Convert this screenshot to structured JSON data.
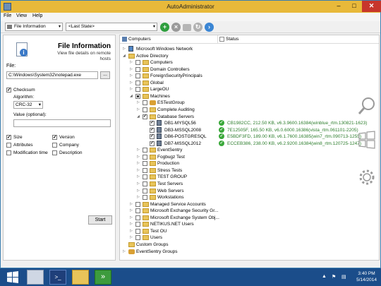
{
  "window": {
    "title": "AutoAdministrator",
    "controls": {
      "minimize": "–",
      "maximize": "□",
      "close": "✕"
    }
  },
  "menu": [
    "File",
    "View",
    "Help"
  ],
  "toolbar": {
    "action_combo": "File Information",
    "state_combo": "<Last State>",
    "buttons": [
      "run",
      "stop",
      "export",
      "refresh",
      "forward"
    ]
  },
  "left_panel": {
    "heading": "File Information",
    "description": "View file details on remote hosts",
    "file_label": "File:",
    "file_value": "C:\\Windows\\System32\\notepad.exe",
    "browse_label": "...",
    "checksum": {
      "label": "Checksum",
      "checked": true
    },
    "algorithm_label": "Algorithm:",
    "algorithm_value": "CRC-32",
    "optional_label": "Value (optional):",
    "optional_value": "",
    "options": [
      {
        "label": "Size",
        "checked": true
      },
      {
        "label": "Version",
        "checked": true
      },
      {
        "label": "Attributes",
        "checked": false
      },
      {
        "label": "Company",
        "checked": false
      },
      {
        "label": "Modification time",
        "checked": false
      },
      {
        "label": "Description",
        "checked": false
      }
    ],
    "start_label": "Start"
  },
  "right_panel": {
    "col_computers": "Computers",
    "col_status": "Status",
    "tree": [
      {
        "label": "Microsoft Windows Network",
        "level": 0,
        "icon": "network",
        "exp": "▷",
        "cb": false
      },
      {
        "label": "Active Directory",
        "level": 0,
        "icon": "folder",
        "exp": "◢",
        "cb": false
      },
      {
        "label": "Computers",
        "level": 1,
        "icon": "folder",
        "exp": "▷",
        "cb": true,
        "checked": false
      },
      {
        "label": "Domain Controllers",
        "level": 1,
        "icon": "folder",
        "exp": "▷",
        "cb": true,
        "checked": false
      },
      {
        "label": "ForeignSecurityPrincipals",
        "level": 1,
        "icon": "folder",
        "exp": "▷",
        "cb": true,
        "checked": false
      },
      {
        "label": "Global",
        "level": 1,
        "icon": "folder",
        "exp": "▷",
        "cb": true,
        "checked": false
      },
      {
        "label": "LargeOU",
        "level": 1,
        "icon": "folder",
        "exp": "▷",
        "cb": true,
        "checked": false
      },
      {
        "label": "Machines",
        "level": 1,
        "icon": "folder",
        "exp": "◢",
        "cb": true,
        "checked": "partial"
      },
      {
        "label": "ESTestGroup",
        "level": 2,
        "icon": "group",
        "exp": "▷",
        "cb": true,
        "checked": false
      },
      {
        "label": "Complete Auditing",
        "level": 2,
        "icon": "folder",
        "exp": "▷",
        "cb": true,
        "checked": false
      },
      {
        "label": "Database Servers",
        "level": 2,
        "icon": "folder",
        "exp": "◢",
        "cb": true,
        "checked": true
      },
      {
        "label": "DB1-MYSQL56",
        "level": 3,
        "icon": "server",
        "exp": "",
        "cb": true,
        "checked": true,
        "status": "CB1982CC, 212.50 KB, v6.3.9600.16384(winblue_rtm.130821-1623)"
      },
      {
        "label": "DB3-MSSQL2008",
        "level": 3,
        "icon": "server",
        "exp": "",
        "cb": true,
        "checked": true,
        "status": "7E12505F, 165.50 KB, v6.0.6000.16386(vista_rtm.061101-2205)"
      },
      {
        "label": "DB6-POSTGRESQL",
        "level": 3,
        "icon": "server",
        "exp": "",
        "cb": true,
        "checked": true,
        "status": "E5BDF3FD, 189.00 KB, v6.1.7600.16385(win7_rtm.090713-1255)"
      },
      {
        "label": "DB7-MSSQL2012",
        "level": 3,
        "icon": "server",
        "exp": "",
        "cb": true,
        "checked": true,
        "status": "ECCEB386, 238.00 KB, v6.2.9200.16384(win8_rtm.120725-1247)"
      },
      {
        "label": "EventSentry",
        "level": 2,
        "icon": "folder",
        "exp": "▷",
        "cb": true,
        "checked": false
      },
      {
        "label": "Fogbugz Test",
        "level": 2,
        "icon": "folder",
        "exp": "▷",
        "cb": true,
        "checked": false
      },
      {
        "label": "Production",
        "level": 2,
        "icon": "folder",
        "exp": "▷",
        "cb": true,
        "checked": false
      },
      {
        "label": "Stress Tests",
        "level": 2,
        "icon": "folder",
        "exp": "▷",
        "cb": true,
        "checked": false
      },
      {
        "label": "TEST GROUP",
        "level": 2,
        "icon": "folder",
        "exp": "▷",
        "cb": true,
        "checked": false
      },
      {
        "label": "Test Servers",
        "level": 2,
        "icon": "folder",
        "exp": "▷",
        "cb": true,
        "checked": false
      },
      {
        "label": "Web Servers",
        "level": 2,
        "icon": "folder",
        "exp": "▷",
        "cb": true,
        "checked": false
      },
      {
        "label": "Workstations",
        "level": 2,
        "icon": "folder",
        "exp": "▷",
        "cb": true,
        "checked": false
      },
      {
        "label": "Managed Service Accounts",
        "level": 1,
        "icon": "folder",
        "exp": "▷",
        "cb": true,
        "checked": false
      },
      {
        "label": "Microsoft Exchange Security Gr...",
        "level": 1,
        "icon": "folder",
        "exp": "▷",
        "cb": true,
        "checked": false
      },
      {
        "label": "Microsoft Exchange System Obj...",
        "level": 1,
        "icon": "folder",
        "exp": "▷",
        "cb": true,
        "checked": false
      },
      {
        "label": "NETIKUS.NET Users",
        "level": 1,
        "icon": "folder",
        "exp": "▷",
        "cb": true,
        "checked": false
      },
      {
        "label": "Test OU",
        "level": 1,
        "icon": "folder",
        "exp": "▷",
        "cb": true,
        "checked": false
      },
      {
        "label": "Users",
        "level": 1,
        "icon": "folder",
        "exp": "▷",
        "cb": true,
        "checked": false
      },
      {
        "label": "Custom Groups",
        "level": 0,
        "icon": "folder",
        "exp": "",
        "cb": false
      },
      {
        "label": "EventSentry Groups",
        "level": 0,
        "icon": "group",
        "exp": "▷",
        "cb": false
      }
    ]
  },
  "taskbar": {
    "apps": [
      "start",
      "server-manager",
      "powershell",
      "file-explorer",
      "autoadministrator"
    ],
    "time": "3:40 PM",
    "date": "5/14/2014"
  },
  "colors": {
    "titlebar": "#e8b93a",
    "ok_green": "#3aa83a",
    "taskbar": "#1b4d8a"
  }
}
